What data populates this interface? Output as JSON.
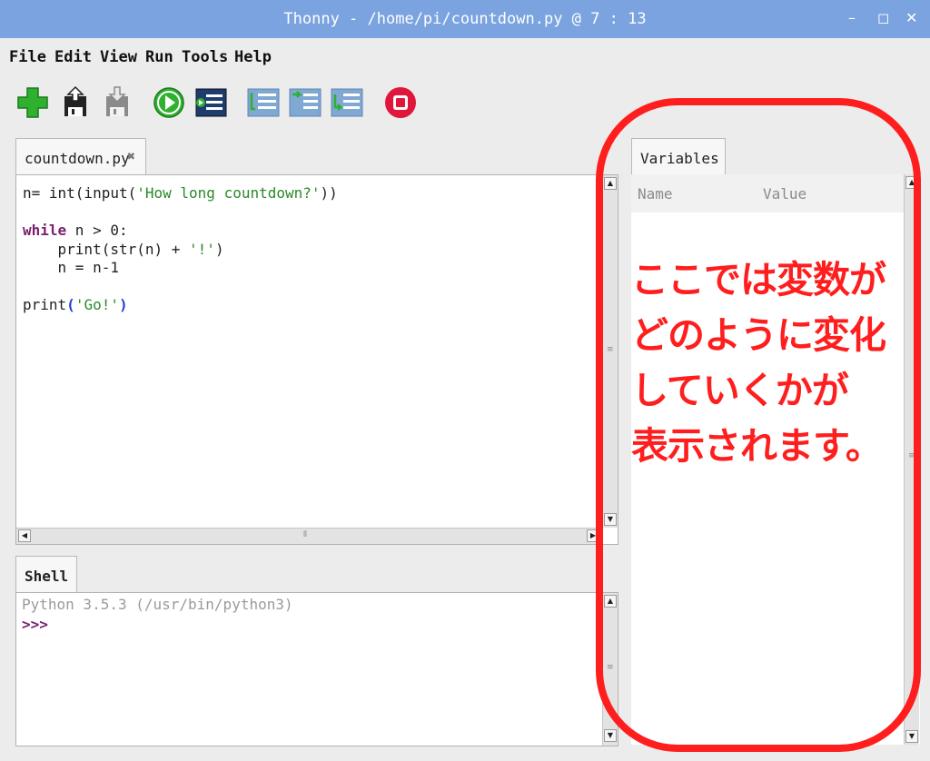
{
  "window": {
    "title": "Thonny  -  /home/pi/countdown.py  @  7 : 13",
    "minimize": "–",
    "maximize": "◻",
    "close": "✕"
  },
  "menu": [
    "File",
    "Edit",
    "View",
    "Run",
    "Tools",
    "Help"
  ],
  "toolbar": {
    "icons": [
      "new-file-icon",
      "open-file-icon",
      "save-file-icon",
      "run-icon",
      "debug-icon",
      "step-over-icon",
      "step-into-icon",
      "step-out-icon",
      "stop-icon"
    ],
    "colors": {
      "green": "#2fb02f",
      "stop": "#e0163a",
      "blue": "#2d6fb8"
    }
  },
  "editor": {
    "tab_label": "countdown.py",
    "tab_close": "✖",
    "lines": [
      "n= int(input('How long countdown?'))",
      "",
      "while n > 0:",
      "    print(str(n) + '!')",
      "    n = n-1",
      "",
      "print('Go!')"
    ]
  },
  "shell": {
    "tab_label": "Shell",
    "banner": "Python 3.5.3 (/usr/bin/python3)",
    "prompt": ">>>"
  },
  "variables": {
    "tab_label": "Variables",
    "col_name": "Name",
    "col_value": "Value"
  },
  "annotation": {
    "text": "ここでは変数が\nどのように変化\nしていくかが\n表示されます。",
    "color": "#ff1e1e"
  }
}
